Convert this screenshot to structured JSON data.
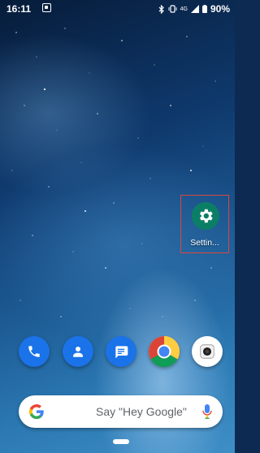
{
  "status_bar": {
    "time": "16:11",
    "network": "4G",
    "battery": "90%"
  },
  "home": {
    "apps": [
      {
        "label": "Settin...",
        "icon": "gear-icon",
        "color": "#0b7f66"
      }
    ]
  },
  "dock": {
    "items": [
      {
        "name": "phone-icon",
        "color": "#1a73e8"
      },
      {
        "name": "contacts-icon",
        "color": "#1a73e8"
      },
      {
        "name": "messages-icon",
        "color": "#1a73e8"
      },
      {
        "name": "chrome-icon",
        "color": "#ffffff"
      },
      {
        "name": "camera-icon",
        "color": "#ffffff"
      }
    ]
  },
  "search_bar": {
    "placeholder": "Say \"Hey Google\""
  }
}
